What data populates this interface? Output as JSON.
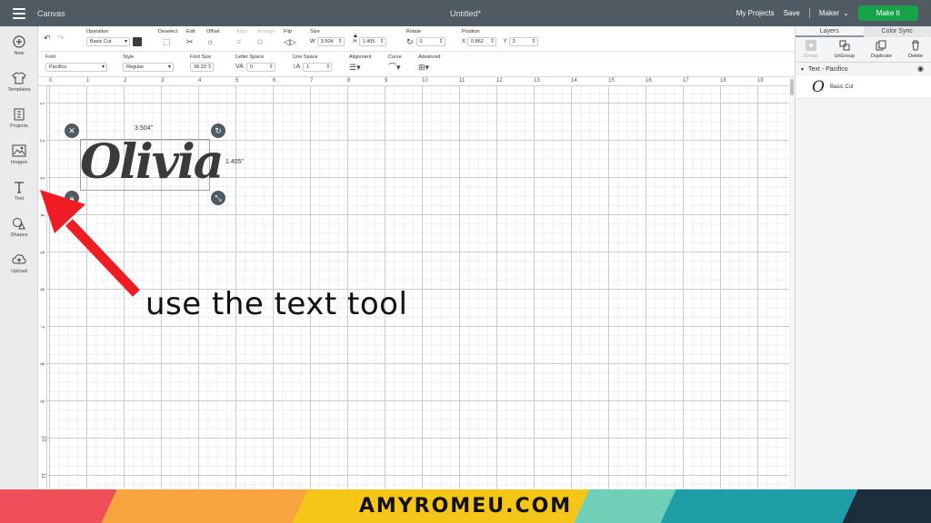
{
  "app": {
    "title": "Canvas",
    "doc_title": "Untitled*"
  },
  "header": {
    "my_projects": "My Projects",
    "save": "Save",
    "machine": "Maker",
    "make_it": "Make It"
  },
  "leftbar": [
    {
      "label": "New",
      "icon": "plus-circle-icon"
    },
    {
      "label": "Templates",
      "icon": "shirt-icon"
    },
    {
      "label": "Projects",
      "icon": "projects-icon"
    },
    {
      "label": "Images",
      "icon": "image-icon"
    },
    {
      "label": "Text",
      "icon": "text-icon"
    },
    {
      "label": "Shapes",
      "icon": "shapes-icon"
    },
    {
      "label": "Upload",
      "icon": "upload-cloud-icon"
    }
  ],
  "toolbar1": {
    "operation_label": "Operation",
    "operation_value": "Basic Cut",
    "swatch_color": "#3c3c3c",
    "deselect_label": "Deselect",
    "edit_label": "Edit",
    "offset_label": "Offset",
    "align_label": "Align",
    "arrange_label": "Arrange",
    "flip_label": "Flip",
    "size_label": "Size",
    "w_label": "W",
    "w_value": "3.504",
    "h_label": "H",
    "h_value": "1.405",
    "rotate_label": "Rotate",
    "rotate_value": "0",
    "position_label": "Position",
    "x_label": "X",
    "x_value": "0.862",
    "y_label": "Y",
    "y_value": "2"
  },
  "toolbar2": {
    "font_label": "Font",
    "font_value": "Pacifico",
    "style_label": "Style",
    "style_value": "Regular",
    "font_size_label": "Font Size",
    "font_size_value": "38.33",
    "letter_space_label": "Letter Space",
    "letter_space_value": "0",
    "line_space_label": "Line Space",
    "line_space_value": "1",
    "alignment_label": "Alignment",
    "curve_label": "Curve",
    "advanced_label": "Advanced"
  },
  "ruler": {
    "h_ticks": [
      "0",
      "1",
      "2",
      "3",
      "4",
      "5",
      "6",
      "7",
      "8",
      "9",
      "10",
      "11",
      "12",
      "13",
      "14",
      "15",
      "16",
      "17",
      "18",
      "19"
    ],
    "v_ticks": [
      "1",
      "2",
      "3",
      "4",
      "5",
      "6",
      "7",
      "8",
      "9",
      "10",
      "11"
    ]
  },
  "canvas": {
    "text": "Olivia",
    "width_label": "3.504\"",
    "height_label": "1.405\""
  },
  "annotation": {
    "caption": "use the text tool",
    "arrow_color": "#ef1c24"
  },
  "rpanel": {
    "tabs": [
      "Layers",
      "Color Sync"
    ],
    "actions": [
      {
        "label": "Group",
        "disabled": true
      },
      {
        "label": "UnGroup",
        "disabled": false
      },
      {
        "label": "Duplicate",
        "disabled": false
      },
      {
        "label": "Delete",
        "disabled": false
      }
    ],
    "layer_title": "Text - Pacifico",
    "layer_glyph": "O",
    "layer_item_label": "Basic Cut"
  },
  "banner": {
    "text": "AMYROMEU.COM",
    "colors": [
      "#ef4f58",
      "#f7a33f",
      "#f5c518",
      "#6fcfb7",
      "#1f9ea8",
      "#1e2d3b"
    ]
  }
}
